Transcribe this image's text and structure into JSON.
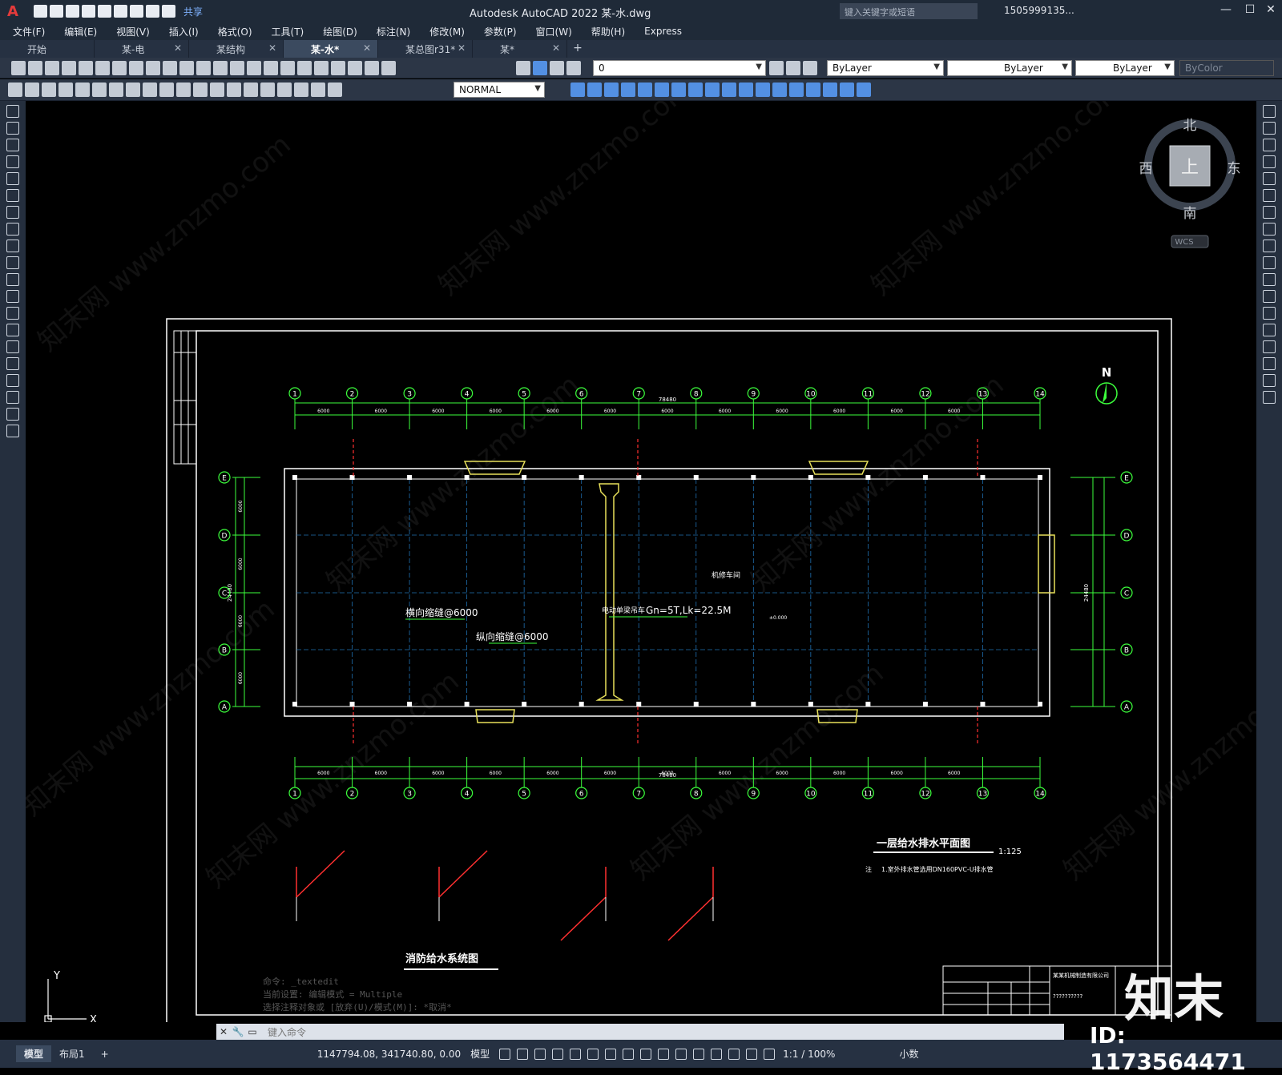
{
  "titlebar": {
    "app_logo": "A",
    "share": "共享",
    "title": "Autodesk AutoCAD 2022    某-水.dwg",
    "search_placeholder": "键入关键字或短语",
    "user": "1505999135...",
    "win_minimize": "—",
    "win_restore": "☐",
    "win_close": "✕"
  },
  "menu": [
    "文件(F)",
    "编辑(E)",
    "视图(V)",
    "插入(I)",
    "格式(O)",
    "工具(T)",
    "绘图(D)",
    "标注(N)",
    "修改(M)",
    "参数(P)",
    "窗口(W)",
    "帮助(H)",
    "Express"
  ],
  "tabs": [
    {
      "label": "开始",
      "close": ""
    },
    {
      "label": "某-电",
      "close": "✕"
    },
    {
      "label": "某结构",
      "close": "✕"
    },
    {
      "label": "某-水*",
      "close": "✕"
    },
    {
      "label": "某总图r31*",
      "close": "✕"
    },
    {
      "label": "某*",
      "close": "✕"
    }
  ],
  "tab_add": "+",
  "toolbar": {
    "layer_value": "0",
    "color_value": "ByLayer",
    "linetype_value": "ByLayer",
    "lineweight_value": "ByLayer",
    "plotstyle_value": "ByColor",
    "dimstyle_value": "NORMAL"
  },
  "viewcube": {
    "north": "北",
    "south": "南",
    "east": "东",
    "west": "西",
    "top": "上",
    "wcs": "WCS"
  },
  "drawing": {
    "north_label": "N",
    "grid_cols": [
      "1",
      "2",
      "3",
      "4",
      "5",
      "6",
      "7",
      "8",
      "9",
      "10",
      "11",
      "12",
      "13",
      "14"
    ],
    "grid_rows": [
      "E",
      "D",
      "C",
      "B",
      "A"
    ],
    "total_length": "78480",
    "total_width": "24480",
    "span": "6000",
    "bay_label": "6000",
    "room_label": "机修车间",
    "crane_label": "电动单梁吊车",
    "crane_spec": "Gn=5T,Lk=22.5M",
    "transverse_joint": "横向缩缝@6000",
    "longitudinal_joint": "纵向缩缝@6000",
    "elevation": "±0.000",
    "plan_title": "一层给水排水平面图",
    "plan_scale": "1:125",
    "note_prefix": "注",
    "note_text": "1.室外排水管选用DN160PVC-U排水管",
    "system_title": "消防给水系统图",
    "company": "某某机械制造有限公司",
    "title_q": "??????????"
  },
  "command": {
    "history": [
      "命令:  _textedit",
      "当前设置: 编辑模式 = Multiple",
      "选择注释对象或 [放弃(U)/模式(M)]: *取消*"
    ],
    "placeholder": "键入命令"
  },
  "status": {
    "tab_model": "模型",
    "tab_layout": "布局1",
    "tab_add": "+",
    "coords": "1147794.08, 341740.80, 0.00",
    "mode": "模型",
    "scale": "1:1 / 100%",
    "units": "小数"
  },
  "watermark": {
    "logo": "知末",
    "id": "ID: 1173564471"
  }
}
